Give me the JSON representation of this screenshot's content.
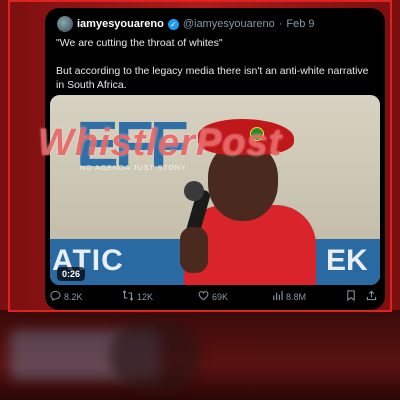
{
  "post": {
    "display_name": "iamyesyouareno",
    "handle": "@iamyesyouareno",
    "separator": "·",
    "date": "Feb 9",
    "text_quote": "\"We are cutting the throat of whites\"",
    "text_comment": "But according to the legacy media there isn't an anti-white narrative in South Africa.",
    "video": {
      "duration": "0:26",
      "scene_text_top": "EFF",
      "scene_text_bottom_left": "ATIC",
      "scene_text_bottom_right": "EK"
    },
    "metrics": {
      "replies": "8.2K",
      "reposts": "12K",
      "likes": "69K",
      "views": "8.8M"
    }
  },
  "watermark": {
    "title": "WhistlerPost",
    "subtitle": "NO AGENDA JUST STORY"
  },
  "colors": {
    "accent_red": "#d22222",
    "verified_blue": "#1d9bf0",
    "card_bg": "#000000",
    "meta_gray": "#8b98a5"
  },
  "icons": {
    "reply": "reply-icon",
    "repost": "repost-icon",
    "like": "heart-icon",
    "views": "views-icon",
    "bookmark": "bookmark-icon",
    "share": "share-icon"
  }
}
